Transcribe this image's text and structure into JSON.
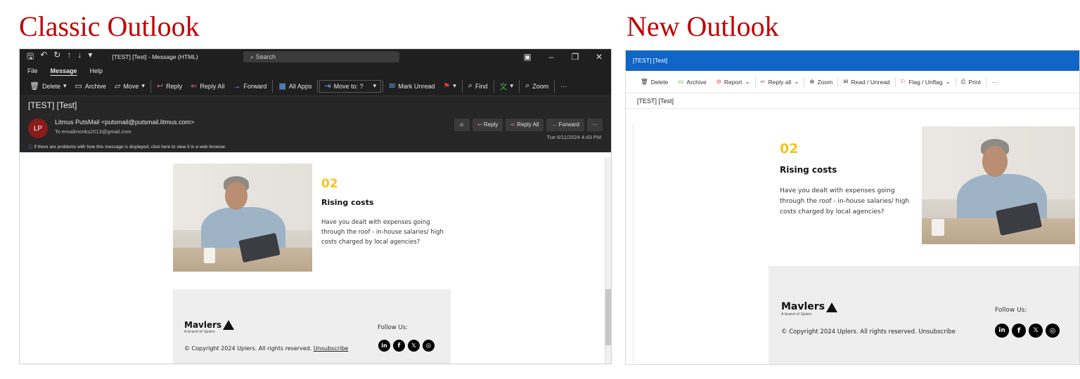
{
  "headings": {
    "classic": "Classic Outlook",
    "new": "New Outlook"
  },
  "classic": {
    "window_title": "[TEST] [Test]  -  Message (HTML)",
    "search_placeholder": "Search",
    "menu": [
      "File",
      "Message",
      "Help"
    ],
    "ribbon": {
      "delete": "Delete",
      "archive": "Archive",
      "move": "Move",
      "reply": "Reply",
      "reply_all": "Reply All",
      "forward": "Forward",
      "all_apps": "All Apps",
      "move_to": "Move to: ?",
      "mark_unread": "Mark Unread",
      "find": "Find",
      "zoom": "Zoom"
    },
    "subject": "[TEST] [Test]",
    "sender": {
      "initials": "LP",
      "name": "Litmus PutsMail <putsmail@putsmail.litmus.com>",
      "to": "To   emailmonks2013@gmail.com",
      "date": "Tue 6/11/2024 4:43 PM",
      "actions": {
        "reply": "Reply",
        "reply_all": "Reply All",
        "forward": "Forward"
      }
    },
    "info_bar": "If there are problems with how this message is displayed, click here to view it in a web browser."
  },
  "new": {
    "window_title": "[TEST] [Test]",
    "toolbar": {
      "delete": "Delete",
      "archive": "Archive",
      "report": "Report",
      "reply_all": "Reply all",
      "zoom": "Zoom",
      "read_unread": "Read / Unread",
      "flag": "Flag / Unflag",
      "print": "Print"
    },
    "subject": "[TEST] [Test]"
  },
  "email": {
    "number": "02",
    "title": "Rising costs",
    "paragraph": "Have you dealt with expenses going through the roof - in-house salaries/ high costs charged by local agencies?",
    "brand": "Mavlers",
    "brand_tag": "A brand of Uplers",
    "copyright": "© Copyright 2024 Uplers. All rights reserved.",
    "unsubscribe": "Unsubscribe",
    "follow": "Follow Us:",
    "social_icons": [
      "linkedin-icon",
      "facebook-icon",
      "x-icon",
      "instagram-icon"
    ]
  },
  "colors": {
    "heading_red": "#c00000",
    "accent_yellow": "#f5c518",
    "new_outlook_blue": "#1066c6",
    "classic_dark": "#1f1f1f"
  }
}
